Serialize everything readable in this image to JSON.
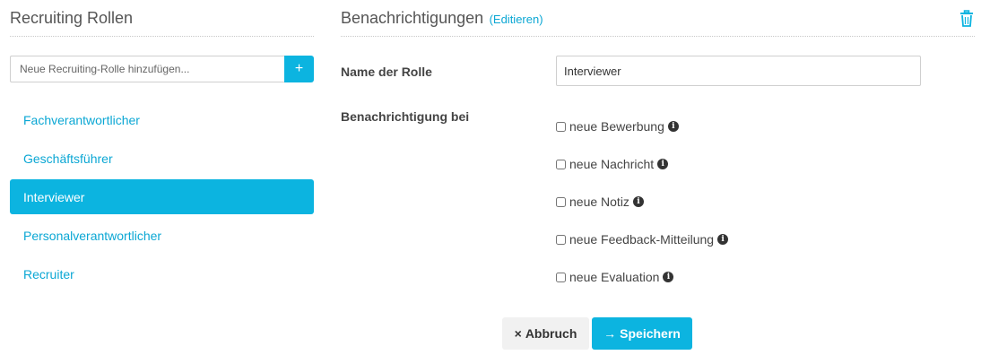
{
  "sidebar": {
    "title": "Recruiting Rollen",
    "add_placeholder": "Neue Recruiting-Rolle hinzufügen...",
    "add_button_label": "+",
    "roles": [
      {
        "label": "Fachverantwortlicher",
        "active": false
      },
      {
        "label": "Geschäftsführer",
        "active": false
      },
      {
        "label": "Interviewer",
        "active": true
      },
      {
        "label": "Personalverantwortlicher",
        "active": false
      },
      {
        "label": "Recruiter",
        "active": false
      }
    ]
  },
  "detail": {
    "title": "Benachrichtigungen",
    "edit_link": "(Editieren)",
    "name_label": "Name der Rolle",
    "name_value": "Interviewer",
    "notify_label": "Benachrichtigung bei",
    "notifications": [
      {
        "label": "neue Bewerbung",
        "checked": false
      },
      {
        "label": "neue Nachricht",
        "checked": false
      },
      {
        "label": "neue Notiz",
        "checked": false
      },
      {
        "label": "neue Feedback-Mitteilung",
        "checked": false
      },
      {
        "label": "neue Evaluation",
        "checked": false
      }
    ],
    "cancel_icon": "×",
    "cancel_label": "Abbruch",
    "save_icon": "→",
    "save_label": "Speichern"
  },
  "colors": {
    "accent": "#0cb4e0",
    "link": "#0ba7d4"
  },
  "icons": {
    "add": "plus-icon",
    "delete": "trash-icon",
    "info": "info-icon",
    "cancel": "close-icon",
    "save": "arrow-right-icon"
  }
}
